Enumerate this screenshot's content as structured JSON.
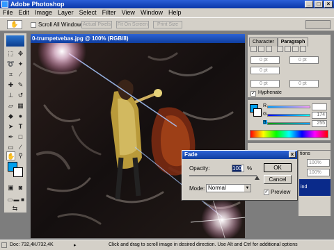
{
  "app": {
    "title": "Adobe Photoshop"
  },
  "window_controls": {
    "minimize": "_",
    "maximize": "□",
    "close": "×"
  },
  "menu": [
    "File",
    "Edit",
    "Image",
    "Layer",
    "Select",
    "Filter",
    "View",
    "Window",
    "Help"
  ],
  "options_bar": {
    "scroll_all_windows": "Scroll All Windows",
    "actual_pixels": "Actual Pixels",
    "fit_on_screen": "Fit On Screen",
    "print_size": "Print Size"
  },
  "document": {
    "title": "0-trumpetvebas.jpg @ 100% (RGB/8)"
  },
  "character_panel": {
    "tabs": [
      "Character",
      "Paragraph"
    ],
    "indent_left": "0 pt",
    "indent_right": "0 pt",
    "indent_first": "0 pt",
    "space_before": "0 pt",
    "space_after": "0 pt",
    "hyphenate_label": "Hyphenate"
  },
  "color_panel": {
    "r_label": "R",
    "g_label": "G",
    "b_label": "B",
    "g_value": "174",
    "b_value": "255"
  },
  "layers_panel": {
    "tab_fragment": "tions",
    "opacity_fragment": "100%",
    "fill_fragment": "100%",
    "layer_fragment": "ind"
  },
  "fade_dialog": {
    "title": "Fade",
    "opacity_label": "Opacity:",
    "opacity_value": "100",
    "percent": "%",
    "mode_label": "Mode:",
    "mode_value": "Normal",
    "ok": "OK",
    "cancel": "Cancel",
    "preview": "Preview",
    "preview_checked": true,
    "opacity_fraction": 1.0
  },
  "status_bar": {
    "doc": "Doc: 732,4K/732,4K",
    "hint": "Click and drag to scroll image in desired direction. Use Alt and Ctrl for additional options"
  },
  "colors": {
    "foreground": "#00a0ee",
    "background": "#ffffff",
    "titlebar": "#0a37a8"
  }
}
